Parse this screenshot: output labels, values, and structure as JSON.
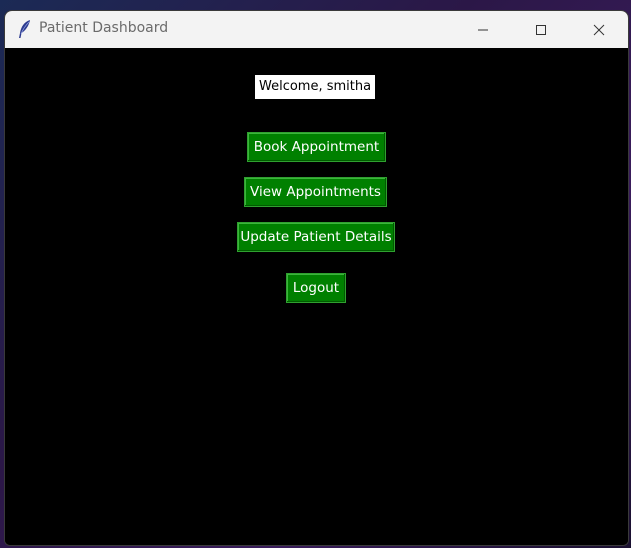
{
  "window": {
    "title": "Patient Dashboard",
    "app_icon": "feather-icon",
    "controls": {
      "minimize_icon": "minimize-icon",
      "maximize_icon": "maximize-icon",
      "close_icon": "close-icon"
    }
  },
  "dashboard": {
    "welcome_text": "Welcome, smitha",
    "buttons": {
      "book": "Book Appointment",
      "view": "View Appointments",
      "update": "Update Patient Details",
      "logout": "Logout"
    }
  },
  "colors": {
    "background": "#000000",
    "button_bg": "#008000",
    "button_text": "#ffffff",
    "titlebar": "#f3f3f3"
  }
}
